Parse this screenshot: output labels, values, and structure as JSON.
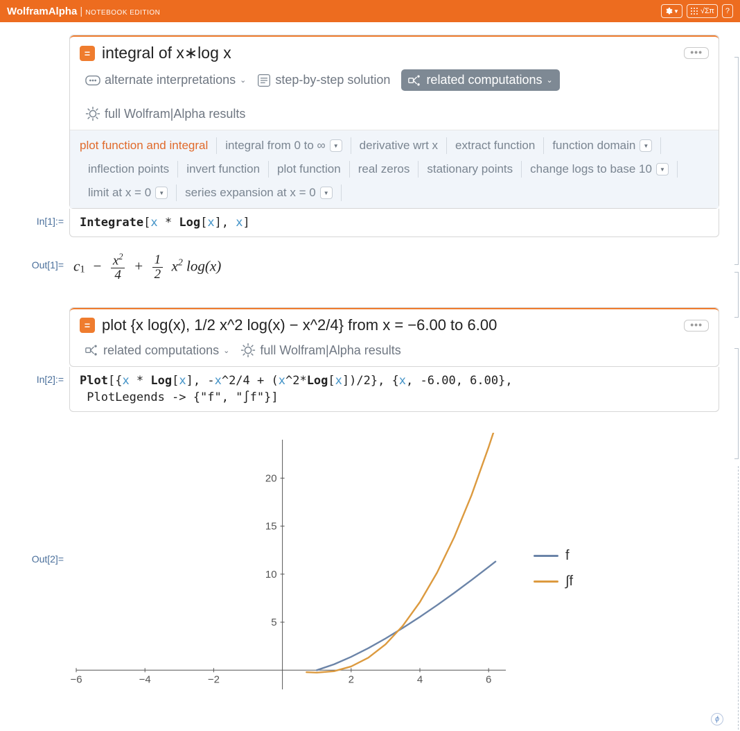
{
  "topbar": {
    "brand_main": "WolframAlpha",
    "brand_sub": "NOTEBOOK EDITION",
    "tool_math": "√Σπ",
    "tool_help": "?"
  },
  "cell1": {
    "in_label": "In[1]:=",
    "out_label": "Out[1]=",
    "query": "integral of x∗log x",
    "dots": "•••",
    "toolbar": {
      "alt": "alternate interpretations",
      "step": "step-by-step solution",
      "related": "related computations",
      "full": "full Wolfram|Alpha results"
    },
    "suggestions": [
      {
        "label": "plot function and integral",
        "sel": true,
        "dd": false
      },
      {
        "label": "integral from 0 to ∞",
        "dd": true
      },
      {
        "label": "derivative wrt x",
        "dd": false
      },
      {
        "label": "extract function",
        "dd": false
      },
      {
        "label": "function domain",
        "dd": true
      },
      {
        "label": "inflection points",
        "dd": false
      },
      {
        "label": "invert function",
        "dd": false
      },
      {
        "label": "plot function",
        "dd": false
      },
      {
        "label": "real zeros",
        "dd": false
      },
      {
        "label": "stationary points",
        "dd": false
      },
      {
        "label": "change logs to base 10",
        "dd": true
      },
      {
        "label": "limit at x = 0",
        "dd": true
      },
      {
        "label": "series expansion at x = 0",
        "dd": true
      }
    ],
    "code_html": "<span class='kw'>Integrate</span>[<span class='var'>x</span> * <span class='kw'>Log</span>[<span class='var'>x</span>], <span class='var'>x</span>]"
  },
  "cell2": {
    "in_label": "In[2]:=",
    "out_label": "Out[2]=",
    "query": "plot {x log(x), 1/2 x^2 log(x) − x^2/4} from x = −6.00 to 6.00",
    "dots": "•••",
    "toolbar": {
      "related": "related computations",
      "full": "full Wolfram|Alpha results"
    },
    "code_line1": "<span class='kw'>Plot</span>[{<span class='var'>x</span> * <span class='kw'>Log</span>[<span class='var'>x</span>], -<span class='var'>x</span>^2/4 + (<span class='var'>x</span>^2*<span class='kw'>Log</span>[<span class='var'>x</span>])/2}, {<span class='var'>x</span>, -6.00, 6.00},",
    "code_line2": "&nbsp;PlotLegends -> {\"f\", \"∫f\"}]"
  },
  "chart_data": {
    "type": "line",
    "xlim": [
      -6,
      6.5
    ],
    "ylim": [
      -2,
      24
    ],
    "xticks": [
      -6,
      -4,
      -2,
      2,
      4,
      6
    ],
    "yticks": [
      5,
      10,
      15,
      20
    ],
    "legend": [
      "f",
      "∫f"
    ],
    "colors": {
      "f": "#6b84a8",
      "int_f": "#dc9a3f"
    },
    "series": [
      {
        "name": "f",
        "x": [
          1.0,
          1.5,
          2.0,
          2.5,
          3.0,
          3.5,
          4.0,
          4.5,
          5.0,
          5.5,
          6.0,
          6.2
        ],
        "y": [
          0.0,
          0.61,
          1.39,
          2.29,
          3.3,
          4.39,
          5.55,
          6.77,
          8.05,
          9.38,
          10.75,
          11.31
        ]
      },
      {
        "name": "∫f",
        "x": [
          0.7,
          1.0,
          1.5,
          2.0,
          2.5,
          3.0,
          3.5,
          4.0,
          4.5,
          5.0,
          5.5,
          6.0,
          6.2
        ],
        "y": [
          -0.21,
          -0.25,
          -0.11,
          0.39,
          1.3,
          2.69,
          4.61,
          7.09,
          10.16,
          13.86,
          18.2,
          23.23,
          25.4
        ]
      }
    ]
  }
}
